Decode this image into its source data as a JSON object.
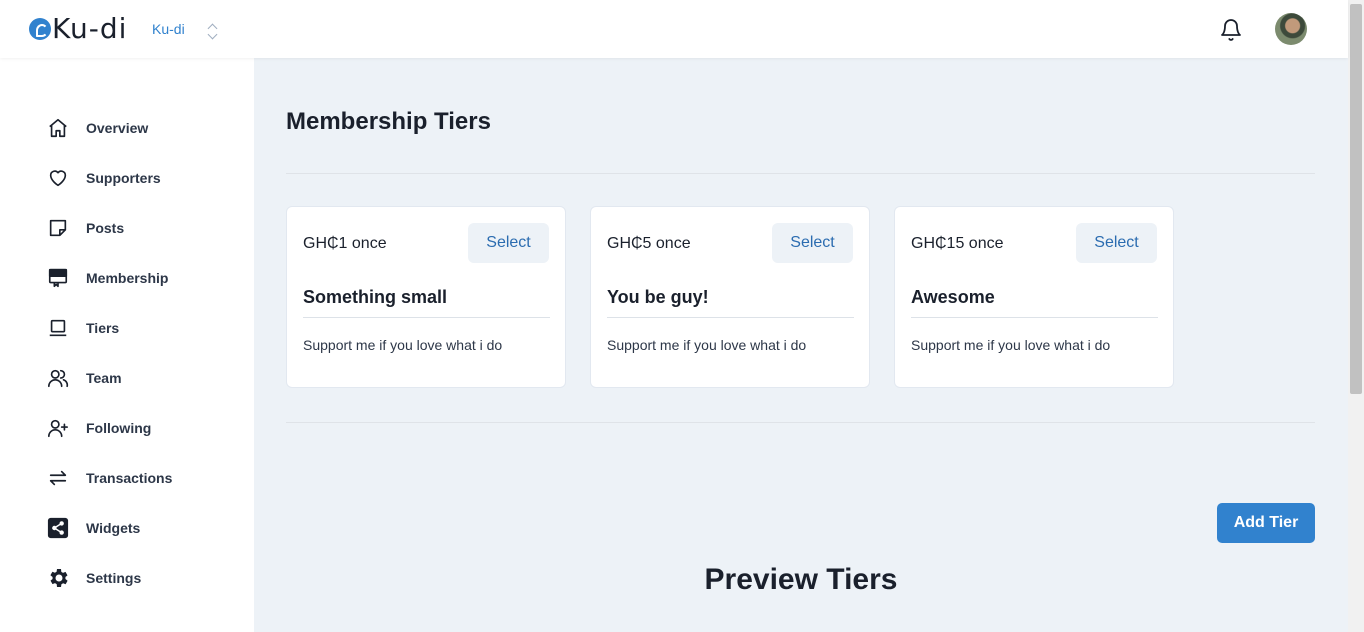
{
  "header": {
    "logo_text": "Ku-di",
    "org_name": "Ku-di"
  },
  "sidebar": {
    "items": [
      {
        "label": "Overview",
        "icon": "home-icon"
      },
      {
        "label": "Supporters",
        "icon": "heart-icon"
      },
      {
        "label": "Posts",
        "icon": "sticky-note-icon"
      },
      {
        "label": "Membership",
        "icon": "card-icon"
      },
      {
        "label": "Tiers",
        "icon": "laptop-icon"
      },
      {
        "label": "Team",
        "icon": "users-icon"
      },
      {
        "label": "Following",
        "icon": "user-plus-icon"
      },
      {
        "label": "Transactions",
        "icon": "arrows-icon"
      },
      {
        "label": "Widgets",
        "icon": "share-icon"
      },
      {
        "label": "Settings",
        "icon": "gear-icon"
      }
    ]
  },
  "main": {
    "title": "Membership Tiers",
    "tiers": [
      {
        "price": "GH₵1 once",
        "select_label": "Select",
        "name": "Something small",
        "description": "Support me if you love what i do"
      },
      {
        "price": "GH₵5 once",
        "select_label": "Select",
        "name": "You be guy!",
        "description": "Support me if you love what i do"
      },
      {
        "price": "GH₵15 once",
        "select_label": "Select",
        "name": "Awesome",
        "description": "Support me if you love what i do"
      }
    ],
    "add_tier_label": "Add Tier",
    "preview_title": "Preview Tiers"
  },
  "colors": {
    "accent": "#3182ce",
    "background": "#edf2f7",
    "text": "#1a202c"
  }
}
